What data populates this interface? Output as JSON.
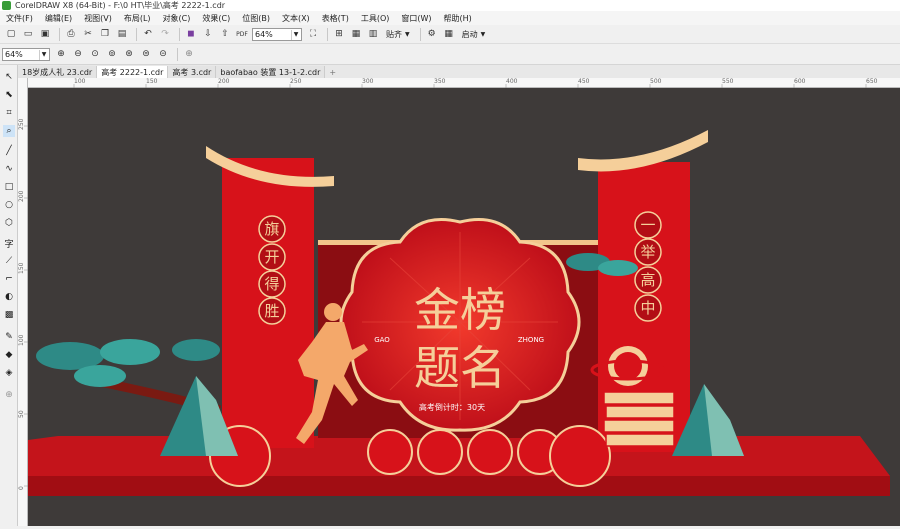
{
  "window": {
    "title": "CorelDRAW X8 (64-Bit) - F:\\0 HT\\毕业\\高考 2222-1.cdr"
  },
  "menu": [
    "文件(F)",
    "编辑(E)",
    "视图(V)",
    "布局(L)",
    "对象(C)",
    "效果(C)",
    "位图(B)",
    "文本(X)",
    "表格(T)",
    "工具(O)",
    "窗口(W)",
    "帮助(H)"
  ],
  "toolbar": {
    "zoom_value": "64%",
    "snap_label": "贴齐",
    "launch_label": "启动"
  },
  "propbar": {
    "zoom_value": "64%"
  },
  "tabs": [
    {
      "label": "18岁成人礼 23.cdr",
      "active": false
    },
    {
      "label": "高考 2222-1.cdr",
      "active": true
    },
    {
      "label": "高考 3.cdr",
      "active": false
    },
    {
      "label": "baofabao 装置 13-1-2.cdr",
      "active": false
    }
  ],
  "ruler": {
    "h_ticks": [
      "100",
      "150",
      "200",
      "250",
      "300",
      "350",
      "400",
      "450",
      "500",
      "550",
      "600",
      "650"
    ],
    "v_ticks": [
      "250",
      "200",
      "150",
      "100",
      "50",
      "0"
    ]
  },
  "artwork": {
    "main_title_line1": "金榜",
    "main_title_line2": "题名",
    "left_latin": "GAO",
    "right_latin": "ZHONG",
    "countdown": "高考倒计时：30天",
    "left_banner_chars": [
      "旗",
      "开",
      "得",
      "胜"
    ],
    "right_banner_chars": [
      "一",
      "举",
      "高",
      "中"
    ]
  },
  "colors": {
    "canvas_bg": "#3e3a39",
    "red": "#d7121a",
    "dark_red": "#a20d12",
    "gold": "#f5cf9a",
    "teal": "#2e8a86"
  }
}
